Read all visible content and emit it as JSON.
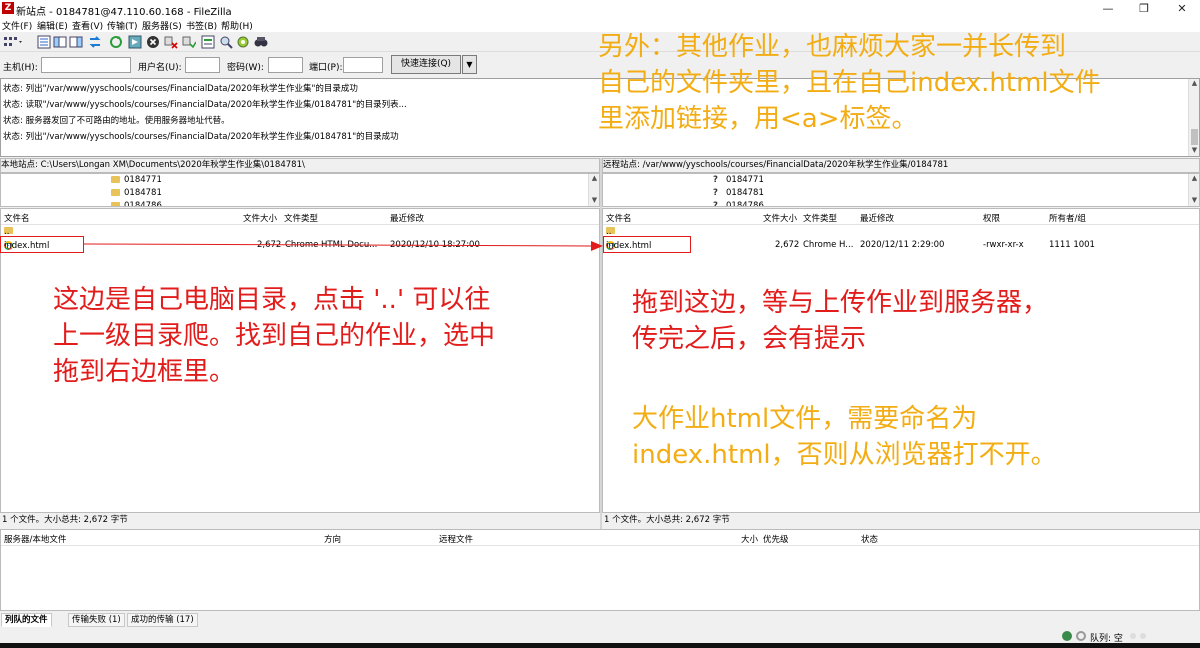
{
  "window": {
    "title": "新站点 - 0184781@47.110.60.168 - FileZilla",
    "icon": "filezilla-icon"
  },
  "menu": [
    "文件(F)",
    "编辑(E)",
    "查看(V)",
    "传输(T)",
    "服务器(S)",
    "书签(B)",
    "帮助(H)"
  ],
  "quickconnect": {
    "host_label": "主机(H):",
    "user_label": "用户名(U):",
    "pass_label": "密码(W):",
    "port_label": "端口(P):",
    "button": "快速连接(Q)"
  },
  "log": [
    "状态: 列出\"/var/www/yyschools/courses/FinancialData/2020年秋学生作业集\"的目录成功",
    "状态: 读取\"/var/www/yyschools/courses/FinancialData/2020年秋学生作业集/0184781\"的目录列表...",
    "状态: 服务器发回了不可路由的地址。使用服务器地址代替。",
    "状态: 列出\"/var/www/yyschools/courses/FinancialData/2020年秋学生作业集/0184781\"的目录成功"
  ],
  "local": {
    "path_label": "本地站点:",
    "path": "C:\\Users\\Longan XM\\Documents\\2020年秋学生作业集\\0184781\\",
    "tree": [
      "0184771",
      "0184781",
      "0184786"
    ],
    "columns": [
      "文件名",
      "文件大小",
      "文件类型",
      "最近修改"
    ],
    "parent": "..",
    "files": [
      {
        "name": "index.html",
        "size": "2,672",
        "type": "Chrome HTML Docu...",
        "modified": "2020/12/10 18:27:00"
      }
    ],
    "status": "1 个文件。大小总共: 2,672 字节"
  },
  "remote": {
    "path_label": "远程站点:",
    "path": "/var/www/yyschools/courses/FinancialData/2020年秋学生作业集/0184781",
    "tree": [
      "0184771",
      "0184781",
      "0184786"
    ],
    "columns": [
      "文件名",
      "文件大小",
      "文件类型",
      "最近修改",
      "权限",
      "所有者/组"
    ],
    "parent": "..",
    "files": [
      {
        "name": "index.html",
        "size": "2,672",
        "type": "Chrome H...",
        "modified": "2020/12/11 2:29:00",
        "perms": "-rwxr-xr-x",
        "owner": "1111 1001"
      }
    ],
    "status": "1 个文件。大小总共: 2,672 字节"
  },
  "queue": {
    "columns": [
      "服务器/本地文件",
      "方向",
      "远程文件",
      "大小",
      "优先级",
      "状态"
    ],
    "tabs": [
      "列队的文件",
      "传输失败 (1)",
      "成功的传输 (17)"
    ],
    "status": "队列: 空"
  },
  "annotations": {
    "top_right": [
      "另外：其他作业，也麻烦大家一并长传到",
      "自己的文件夹里，且在自己index.html文件",
      "里添加链接，用<a>标签。"
    ],
    "left": [
      "这边是自己电脑目录，点击 '..' 可以往",
      "上一级目录爬。找到自己的作业，选中",
      "拖到右边框里。"
    ],
    "right": [
      "拖到这边，等与上传作业到服务器，",
      "传完之后，会有提示"
    ],
    "bottom_right": [
      "大作业html文件，需要命名为",
      "index.html，否则从浏览器打不开。"
    ]
  },
  "colors": {
    "annotation_red": "#e21b1b",
    "annotation_yellow": "#f3ad14",
    "app_red": "#bf0000"
  }
}
